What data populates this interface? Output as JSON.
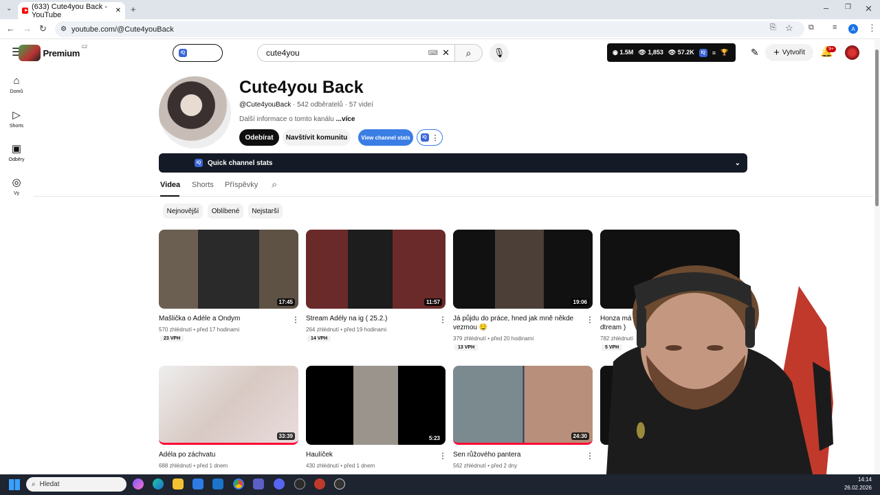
{
  "browser": {
    "tab_title": "(633) Cute4you Back - YouTube",
    "url": "youtube.com/@Cute4youBack"
  },
  "header": {
    "logo_text": "Premium",
    "region": "CZ",
    "search_value": "cute4you",
    "stats": {
      "views": "1.5M",
      "count": "1,853",
      "subs": "57.2K"
    },
    "create_label": "Vytvořit",
    "notif_badge": "9+"
  },
  "sidebar": {
    "items": [
      {
        "label": "Domů",
        "icon": "home-icon"
      },
      {
        "label": "Shorts",
        "icon": "shorts-icon"
      },
      {
        "label": "Odběry",
        "icon": "subscriptions-icon"
      },
      {
        "label": "Vy",
        "icon": "you-icon"
      }
    ]
  },
  "channel": {
    "title": "Cute4you Back",
    "handle": "@Cute4youBack",
    "subscribers": "542 odběratelů",
    "videos_count": "57 videí",
    "more_text": "Další informace o tomto kanálu",
    "more_link": "...více",
    "subscribe_label": "Odebírat",
    "community_label": "Navštívit komunitu",
    "stats_label": "View channel stats",
    "quick_stats": "Quick channel stats"
  },
  "tabs": [
    "Videa",
    "Shorts",
    "Příspěvky"
  ],
  "chips": [
    "Nejnovější",
    "Oblíbené",
    "Nejstarší"
  ],
  "videos": [
    {
      "title": "Mašlička o Adéle a Ondym",
      "views": "570 zhlédnutí",
      "age": "před 17 hodinami",
      "vph": "23 VPH",
      "duration": "17:45"
    },
    {
      "title": "Stream Adély na ig ( 25.2.)",
      "views": "264 zhlédnutí",
      "age": "před 19 hodinami",
      "vph": "14 VPH",
      "duration": "11:57"
    },
    {
      "title": "Já půjdu do práce, hned jak mně někde vezmou 🤤",
      "views": "379 zhlédnutí",
      "age": "před 20 hodinami",
      "vph": "13 VPH",
      "duration": "19:06"
    },
    {
      "title": "Honza má tr",
      "title2": "dtream )",
      "views": "782 zhlédnutí",
      "age": "",
      "vph": "5 VPH",
      "duration": ""
    },
    {
      "title": "Adéla po záchvatu",
      "views": "688 zhlédnutí",
      "age": "před 1 dnem",
      "duration": "33:39"
    },
    {
      "title": "Haulíček",
      "views": "430 zhlédnutí",
      "age": "před 1 dnem",
      "duration": "5:23"
    },
    {
      "title": "Sen růžového pantera",
      "views": "562 zhlédnutí",
      "age": "před 2 dny",
      "duration": "24:30"
    }
  ],
  "taskbar": {
    "search_placeholder": "Hledat",
    "time": "14:14",
    "date": "26.02.2026"
  }
}
